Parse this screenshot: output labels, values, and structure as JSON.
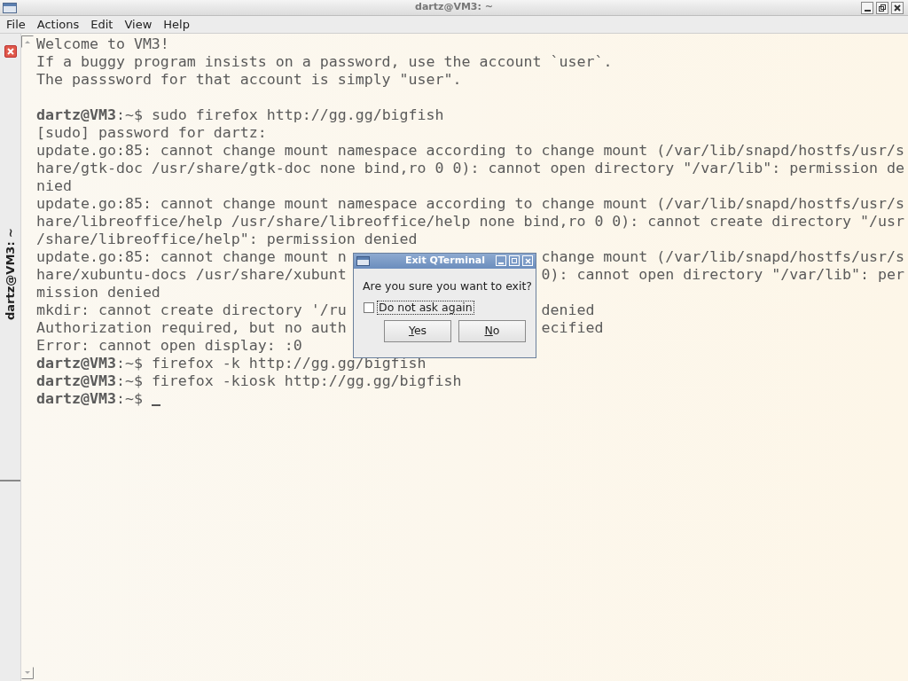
{
  "window": {
    "title": "dartz@VM3: ~"
  },
  "menu": [
    "File",
    "Actions",
    "Edit",
    "View",
    "Help"
  ],
  "tab": {
    "title": "dartz@VM3: ~"
  },
  "terminal": {
    "lines": [
      {
        "kind": "text",
        "text": "Welcome to VM3!"
      },
      {
        "kind": "text",
        "text": "If a buggy program insists on a password, use the account `user`."
      },
      {
        "kind": "text",
        "text": "The passsword for that account is simply \"user\"."
      },
      {
        "kind": "blank"
      },
      {
        "kind": "prompt",
        "user": "dartz@VM3",
        "rest": ":~$ sudo firefox http://gg.gg/bigfish"
      },
      {
        "kind": "text",
        "text": "[sudo] password for dartz:"
      },
      {
        "kind": "text",
        "text": "update.go:85: cannot change mount namespace according to change mount (/var/lib/snapd/hostfs/usr/s"
      },
      {
        "kind": "text",
        "text": "hare/gtk-doc /usr/share/gtk-doc none bind,ro 0 0): cannot open directory \"/var/lib\": permission de"
      },
      {
        "kind": "text",
        "text": "nied"
      },
      {
        "kind": "text",
        "text": "update.go:85: cannot change mount namespace according to change mount (/var/lib/snapd/hostfs/usr/s"
      },
      {
        "kind": "text",
        "text": "hare/libreoffice/help /usr/share/libreoffice/help none bind,ro 0 0): cannot create directory \"/usr"
      },
      {
        "kind": "text",
        "text": "/share/libreoffice/help\": permission denied"
      },
      {
        "kind": "split",
        "text": "update.go:85: cannot change mount n",
        "right": "change mount (/var/lib/snapd/hostfs/usr/s"
      },
      {
        "kind": "split",
        "text": "hare/xubuntu-docs /usr/share/xubunt",
        "right": "0): cannot open directory \"/var/lib\": per"
      },
      {
        "kind": "text",
        "text": "mission denied"
      },
      {
        "kind": "split",
        "text": "mkdir: cannot create directory '/ru",
        "right": "denied"
      },
      {
        "kind": "split",
        "text": "Authorization required, but no auth",
        "right": "ecified"
      },
      {
        "kind": "text",
        "text": "Error: cannot open display: :0"
      },
      {
        "kind": "prompt",
        "user": "dartz@VM3",
        "rest": ":~$ firefox -k http://gg.gg/bigfish"
      },
      {
        "kind": "prompt",
        "user": "dartz@VM3",
        "rest": ":~$ firefox -kiosk http://gg.gg/bigfish"
      },
      {
        "kind": "prompt",
        "user": "dartz@VM3",
        "rest": ":~$ ",
        "cursor": true
      }
    ]
  },
  "dialog": {
    "title": "Exit QTerminal",
    "message": "Are you sure you want to exit?",
    "checkbox": {
      "label": "Do not ask again",
      "checked": false
    },
    "buttons": [
      "Yes",
      "No"
    ]
  }
}
